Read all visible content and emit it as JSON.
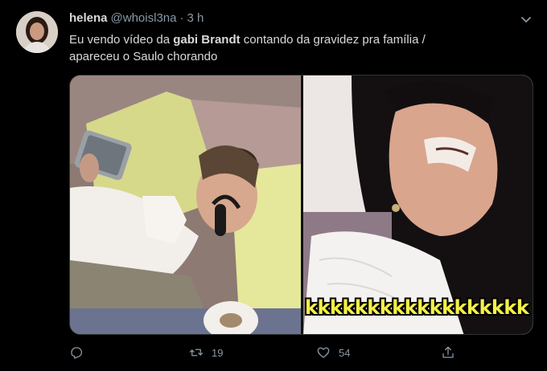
{
  "tweet": {
    "author": {
      "display_name": "helena",
      "handle": "@whoisl3na",
      "separator": "·",
      "timestamp": "3 h"
    },
    "text": {
      "part1": "Eu vendo vídeo da ",
      "bold": "gabi Brandt",
      "part2": " contando da gravidez pra família /",
      "line2": "apareceu o Saulo chorando"
    },
    "media": {
      "right_caption": "kkkkkkkkkkkkkkkkkk"
    },
    "actions": {
      "reply_count": "",
      "retweet_count": "19",
      "like_count": "54"
    }
  },
  "icons": {
    "menu": "chevron-down-icon",
    "reply": "reply-icon",
    "retweet": "retweet-icon",
    "like": "heart-icon",
    "share": "share-icon"
  },
  "colors": {
    "background": "#000000",
    "text": "#d9d9d9",
    "muted": "#8899a6",
    "caption": "#f5f048"
  }
}
